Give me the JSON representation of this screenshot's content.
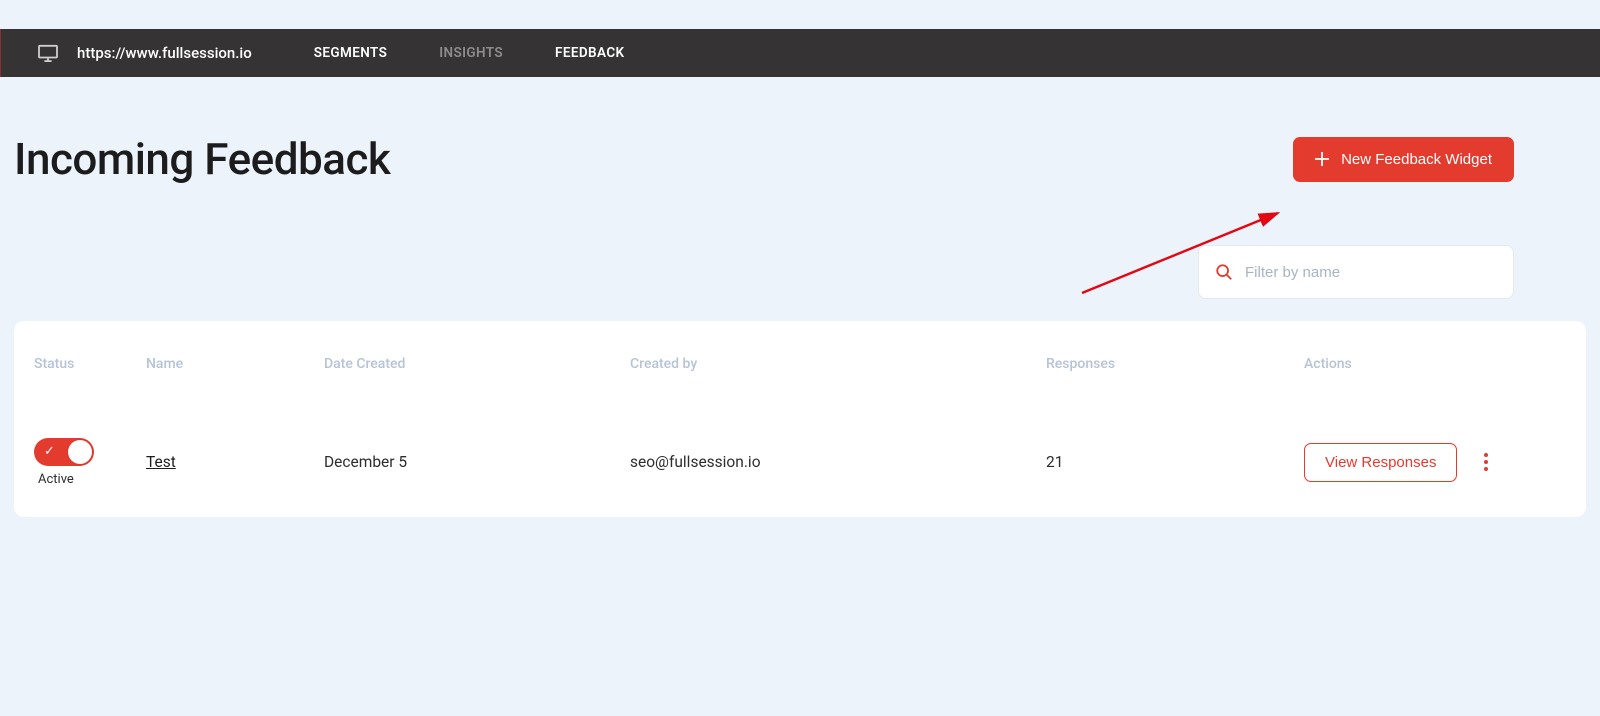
{
  "header": {
    "site_url": "https://www.fullsession.io",
    "nav": [
      {
        "label": "SEGMENTS",
        "active": true
      },
      {
        "label": "INSIGHTS",
        "active": false
      },
      {
        "label": "FEEDBACK",
        "active": true
      }
    ]
  },
  "page": {
    "title": "Incoming Feedback",
    "new_button_label": "New Feedback Widget"
  },
  "search": {
    "placeholder": "Filter by name"
  },
  "table": {
    "columns": {
      "status": "Status",
      "name": "Name",
      "date_created": "Date Created",
      "created_by": "Created by",
      "responses": "Responses",
      "actions": "Actions"
    },
    "rows": [
      {
        "status_active": true,
        "status_label": "Active",
        "name": "Test",
        "date_created": "December 5",
        "created_by": "seo@fullsession.io",
        "responses": "21",
        "action_label": "View Responses"
      }
    ]
  },
  "colors": {
    "accent": "#e33b2e",
    "topbar": "#353334",
    "background": "#ecf3fb"
  }
}
